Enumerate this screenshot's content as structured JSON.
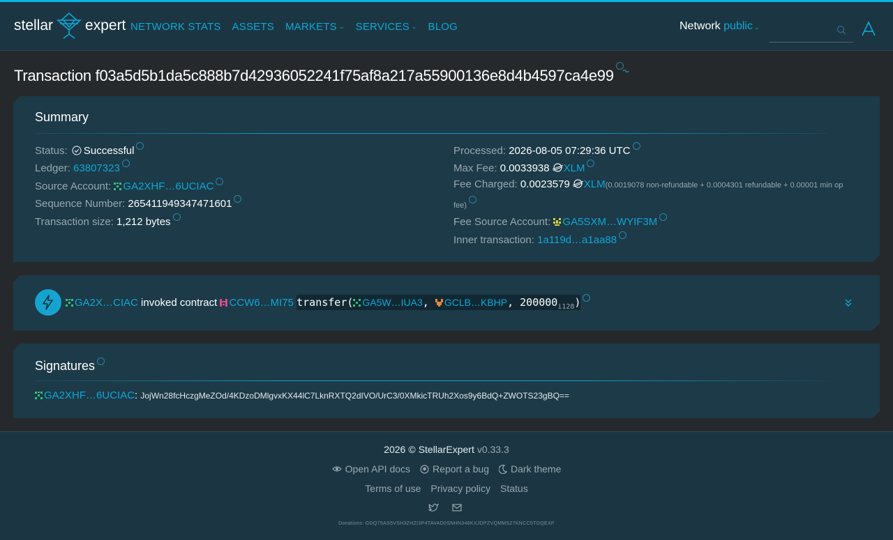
{
  "header": {
    "logo_left": "stellar",
    "logo_right": "expert",
    "nav": [
      {
        "label": "NETWORK STATS",
        "dropdown": false
      },
      {
        "label": "ASSETS",
        "dropdown": false
      },
      {
        "label": "MARKETS",
        "dropdown": true
      },
      {
        "label": "SERVICES",
        "dropdown": true
      },
      {
        "label": "BLOG",
        "dropdown": false
      }
    ],
    "network_label": "Network",
    "network_value": "public",
    "search_placeholder": ""
  },
  "page": {
    "title": "Transaction f03a5d5b1da5c888b7d42936052241f75af8a217a55900136e8d4b4597ca4e99"
  },
  "summary": {
    "heading": "Summary",
    "left": {
      "status_label": "Status:",
      "status_value": "Successful",
      "ledger_label": "Ledger:",
      "ledger_value": "63807323",
      "source_label": "Source Account:",
      "source_value": "GA2XHF…6UCIAC",
      "sequence_label": "Sequence Number:",
      "sequence_value": "265411949347471601",
      "size_label": "Transaction size:",
      "size_value": "1,212 bytes"
    },
    "right": {
      "processed_label": "Processed:",
      "processed_value": "2026-08-05 07:29:36 UTC",
      "maxfee_label": "Max Fee:",
      "maxfee_value": "0.0033938",
      "maxfee_asset": "XLM",
      "charged_label": "Fee Charged:",
      "charged_value": "0.0023579",
      "charged_asset": "XLM",
      "charged_detail_1": "(0.0019078 non-refundable + 0.0004301 refundable + 0.00001 min op",
      "charged_detail_2": "fee)",
      "feesource_label": "Fee Source Account:",
      "feesource_value": "GA5SXM…WYIF3M",
      "inner_label": "Inner transaction:",
      "inner_value": "1a119d…a1aa88"
    }
  },
  "operation": {
    "account": "GA2X…CIAC",
    "verb": "invoked contract",
    "contract": "CCW6…MI75",
    "call_prefix": "transfer(",
    "arg1": "GA5W…IUA3",
    "sep1": ", ",
    "arg2": "GCLB…KBHP",
    "sep2": ", ",
    "amount": "200000",
    "amount_sub": "i128",
    "call_suffix": ")"
  },
  "signatures": {
    "heading": "Signatures",
    "signer": "GA2XHF…6UCIAC",
    "colon": ":",
    "signature": "JojWn28fcHczgMeZOd/4KDzoDMlgvxKX44lC7LknRXTQ2dIVO/UrC3/0XMkicTRUh2Xos9y6BdQ+ZWOTS23gBQ=="
  },
  "footer": {
    "year": "2026",
    "brand": "StellarExpert",
    "version": "v0.33.3",
    "links_row1": [
      "Open API docs",
      "Report a bug",
      "Dark theme"
    ],
    "links_row2": [
      "Terms of use",
      "Privacy policy",
      "Status"
    ],
    "donations": "Donations: GDQ75AS5VSH3ZHZI3P4TAVAD0SNHN346KXJDPZVQMMS27KNCC5TOQEXP"
  },
  "colors": {
    "accent": "#0ea7d8",
    "background": "#26292c",
    "card": "#1c3a47",
    "header": "#1b3642"
  }
}
